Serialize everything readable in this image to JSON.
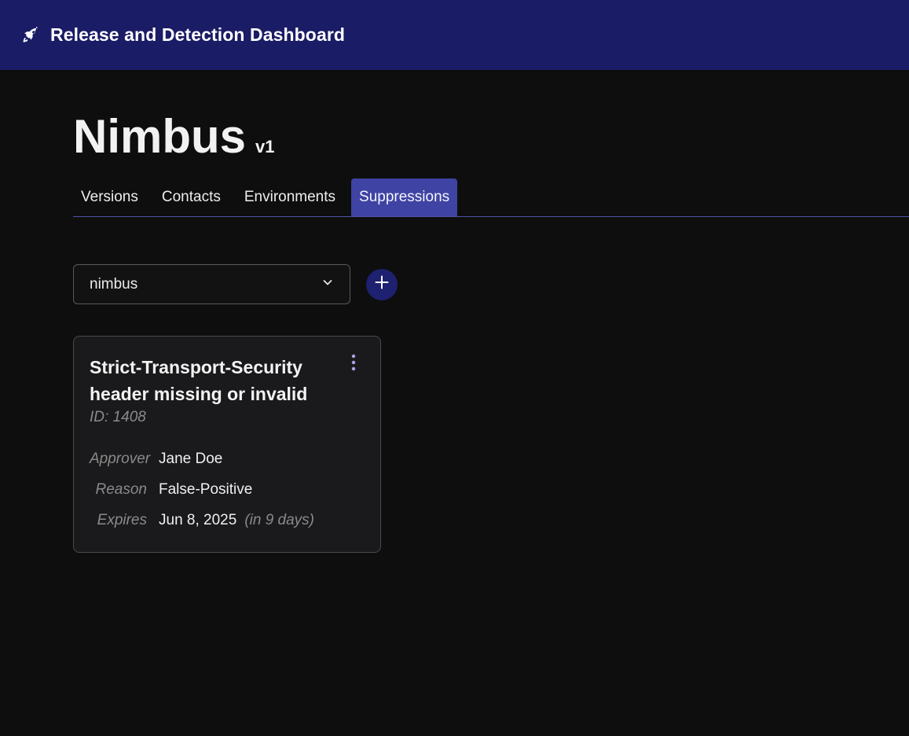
{
  "header": {
    "app_title": "Release and Detection Dashboard",
    "logo_icon": "rocket-icon",
    "background_color": "#1b1c66"
  },
  "project": {
    "name": "Nimbus",
    "version": "v1"
  },
  "tabs": [
    {
      "label": "Versions",
      "active": false
    },
    {
      "label": "Contacts",
      "active": false
    },
    {
      "label": "Environments",
      "active": false
    },
    {
      "label": "Suppressions",
      "active": true
    }
  ],
  "filter": {
    "selected": "nimbus",
    "dropdown_icon": "chevron-down-icon",
    "add_icon": "plus-icon"
  },
  "suppression": {
    "title": "Strict-Transport-Security header missing or invalid",
    "id_text": "ID: 1408",
    "menu_icon": "more-vertical-icon",
    "approver_label": "Approver",
    "approver_value": "Jane Doe",
    "reason_label": "Reason",
    "reason_value": "False-Positive",
    "expires_label": "Expires",
    "expires_value": "Jun 8, 2025",
    "expires_relative": "(in 9 days)"
  },
  "colors": {
    "accent": "#3f43a3",
    "page_background": "#0e0e0e",
    "card_background": "#1a1a1c"
  }
}
